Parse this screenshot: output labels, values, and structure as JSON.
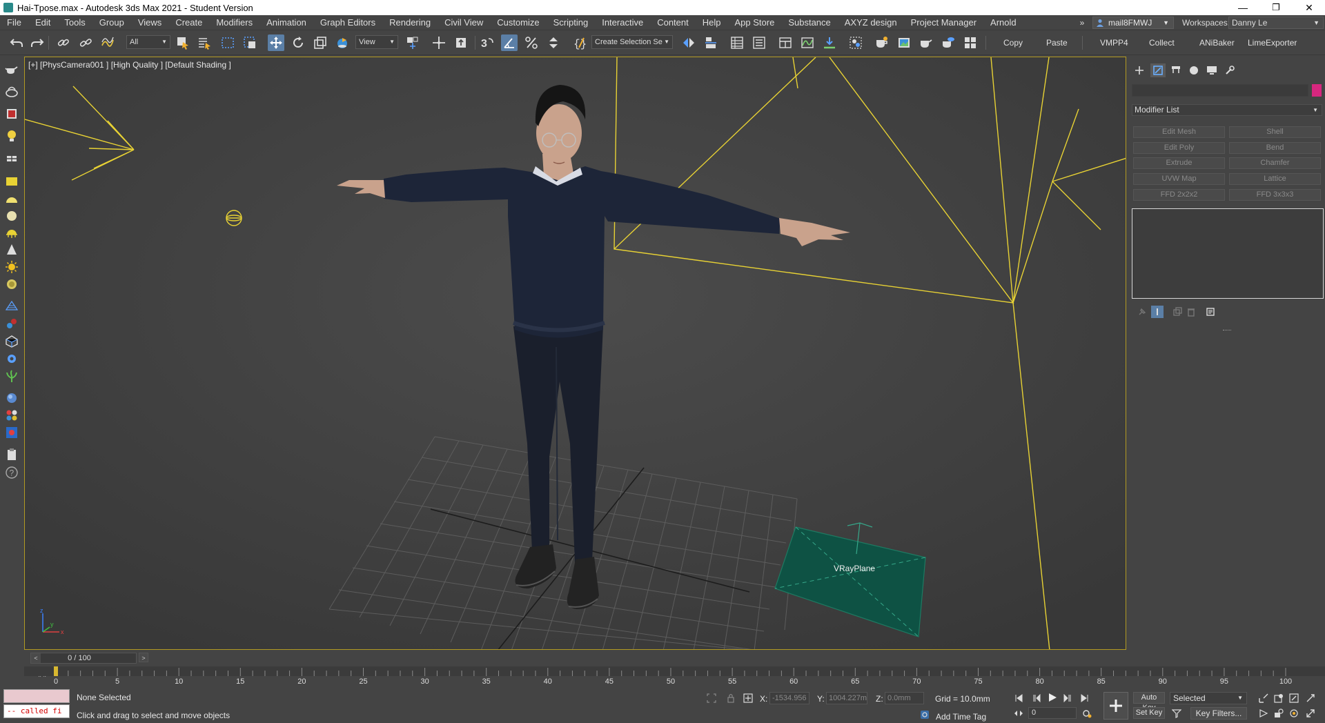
{
  "window": {
    "title": "Hai-Tpose.max - Autodesk 3ds Max 2021 - Student Version",
    "minimize": "—",
    "restore": "❐",
    "close": "✕"
  },
  "menubar": {
    "items": [
      "File",
      "Edit",
      "Tools",
      "Group",
      "Views",
      "Create",
      "Modifiers",
      "Animation",
      "Graph Editors",
      "Rendering",
      "Civil View",
      "Customize",
      "Scripting",
      "Interactive",
      "Content",
      "Help",
      "App Store",
      "Substance",
      "AXYZ design",
      "Project Manager",
      "Arnold"
    ],
    "overflow": "»",
    "user": "mail8FMWJ",
    "workspaces_label": "Workspaces:",
    "workspace": "Danny Le"
  },
  "toolbar": {
    "selection_filter": "All",
    "ref_coord": "View",
    "named_selection": "Create Selection Se",
    "copy": "Copy",
    "paste": "Paste",
    "plugins": [
      "VMPP4",
      "Collect",
      "ANiBaker",
      "LimeExporter"
    ],
    "snap_label": "3"
  },
  "viewport": {
    "label": "[+] [PhysCamera001 ] [High Quality ] [Default Shading ]",
    "vray_plane_label": "VRayPlane",
    "axis_z": "z",
    "axis_x": "x",
    "axis_y": "y"
  },
  "command_panel": {
    "modifier_list": "Modifier List",
    "modifiers": [
      "Edit Mesh",
      "Shell",
      "Edit Poly",
      "Bend",
      "Extrude",
      "Chamfer",
      "UVW Map",
      "Lattice",
      "FFD 2x2x2",
      "FFD 3x3x3"
    ],
    "object_color": "#d7277f"
  },
  "timeline": {
    "slider_value": "0 / 100",
    "prev": "<",
    "next": ">",
    "tick_labels": [
      "0",
      "5",
      "10",
      "15",
      "20",
      "25",
      "30",
      "35",
      "40",
      "45",
      "50",
      "55",
      "60",
      "65",
      "70",
      "75",
      "80",
      "85",
      "90",
      "95",
      "100"
    ]
  },
  "statusbar": {
    "maxscript_output": "-- called fi",
    "selection_status": "None Selected",
    "prompt": "Click and drag to select and move objects",
    "x_label": "X:",
    "x_value": "-1534.956",
    "y_label": "Y:",
    "y_value": "1004.227m",
    "z_label": "Z:",
    "z_value": "0.0mm",
    "grid": "Grid = 10.0mm",
    "add_time_tag": "Add Time Tag",
    "auto_key": "Auto Key",
    "set_key": "Set Key",
    "key_mode": "Selected",
    "key_filters": "Key Filters...",
    "current_frame": "0"
  },
  "colors": {
    "viewport_border": "#b39b22",
    "light_wire": "#e8d234",
    "vray_plane": "#0e5244",
    "active_tool": "#5b7fa6"
  }
}
